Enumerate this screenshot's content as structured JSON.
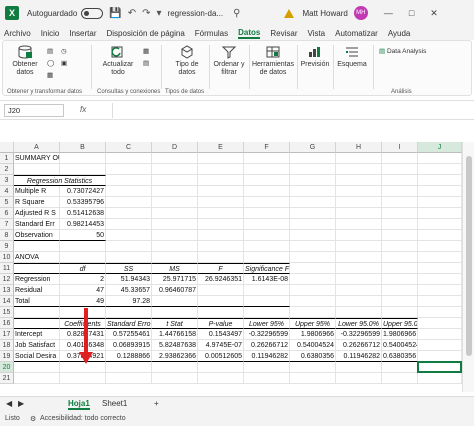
{
  "titlebar": {
    "app_icon": "X",
    "autosave_label": "Autoguardado",
    "filename": "regression-da...",
    "user_name": "Matt Howard",
    "user_initials": "MH"
  },
  "menu": [
    "Archivo",
    "Inicio",
    "Insertar",
    "Disposición de página",
    "Fórmulas",
    "Datos",
    "Revisar",
    "Vista",
    "Automatizar",
    "Ayuda"
  ],
  "menu_active": "Datos",
  "ribbon": {
    "btn_obtener": "Obtener\ndatos",
    "btn_actualizar": "Actualizar\ntodo",
    "btn_tipo": "Tipo de\ndatos",
    "btn_ordenar": "Ordenar y\nfiltrar",
    "btn_herramientas": "Herramientas\nde datos",
    "btn_prevision": "Previsión",
    "btn_esquema": "Esquema",
    "btn_data_analysis": "Data Analysis",
    "group_obtener": "Obtener y transformar datos",
    "group_consultas": "Consultas y conexiones",
    "group_tipos": "Tipos de datos",
    "group_analisis": "Análisis"
  },
  "formula_bar": {
    "name_box": "J20",
    "fx_label": "fx",
    "content": ""
  },
  "columns": [
    "A",
    "B",
    "C",
    "D",
    "E",
    "F",
    "G",
    "H",
    "I",
    "J"
  ],
  "rows": [
    "1",
    "2",
    "3",
    "4",
    "5",
    "6",
    "7",
    "8",
    "9",
    "10",
    "11",
    "12",
    "13",
    "14",
    "15",
    "16",
    "17",
    "18",
    "19",
    "20",
    "21"
  ],
  "sheet": {
    "r1": {
      "A": "SUMMARY OUTPUT"
    },
    "r3": {
      "A": "Regression Statistics"
    },
    "r4": {
      "A": "Multiple R",
      "B": "0.73072427"
    },
    "r5": {
      "A": "R Square",
      "B": "0.53395796"
    },
    "r6": {
      "A": "Adjusted R S",
      "B": "0.51412638"
    },
    "r7": {
      "A": "Standard Err",
      "B": "0.98214453"
    },
    "r8": {
      "A": "Observation",
      "B": "50"
    },
    "r10": {
      "A": "ANOVA"
    },
    "r11": {
      "B": "df",
      "C": "SS",
      "D": "MS",
      "E": "F",
      "F": "Significance F"
    },
    "r12": {
      "A": "Regression",
      "B": "2",
      "C": "51.94343",
      "D": "25.971715",
      "E": "26.9246351",
      "F": "1.6143E-08"
    },
    "r13": {
      "A": "Residual",
      "B": "47",
      "C": "45.33657",
      "D": "0.96460787"
    },
    "r14": {
      "A": "Total",
      "B": "49",
      "C": "97.28"
    },
    "r16": {
      "B": "Coefficients",
      "C": "Standard Erro",
      "D": "t Stat",
      "E": "P-value",
      "F": "Lower 95%",
      "G": "Upper 95%",
      "H": "Lower 95.0%",
      "I": "Upper 95.0%"
    },
    "r17": {
      "A": "Intercept",
      "B": "0.82837431",
      "C": "0.57255461",
      "D": "1.44766158",
      "E": "0.1543497",
      "F": "-0.32296599",
      "G": "1.9806966",
      "H": "-0.32296599",
      "I": "1.9806966"
    },
    "r18": {
      "A": "Job Satisfact",
      "B": "0.40156348",
      "C": "0.06893915",
      "D": "5.82487638",
      "E": "4.9745E-07",
      "F": "0.26266712",
      "G": "0.54004524",
      "H": "0.26266712",
      "I": "0.54004524"
    },
    "r19": {
      "A": "Social Desira",
      "B": "0.37874921",
      "C": "0.1288866",
      "D": "2.93862366",
      "E": "0.00512605",
      "F": "0.11946282",
      "G": "0.6380356",
      "H": "0.11946282",
      "I": "0.6380356"
    }
  },
  "tabs": {
    "active": "Hoja1",
    "other": "Sheet1",
    "add": "+"
  },
  "status": {
    "ready": "Listo",
    "accessibility": "Accesibilidad: todo correcto"
  },
  "colors": {
    "excel_green": "#107c41",
    "arrow_red": "#e02020",
    "avatar": "#c239b3"
  }
}
